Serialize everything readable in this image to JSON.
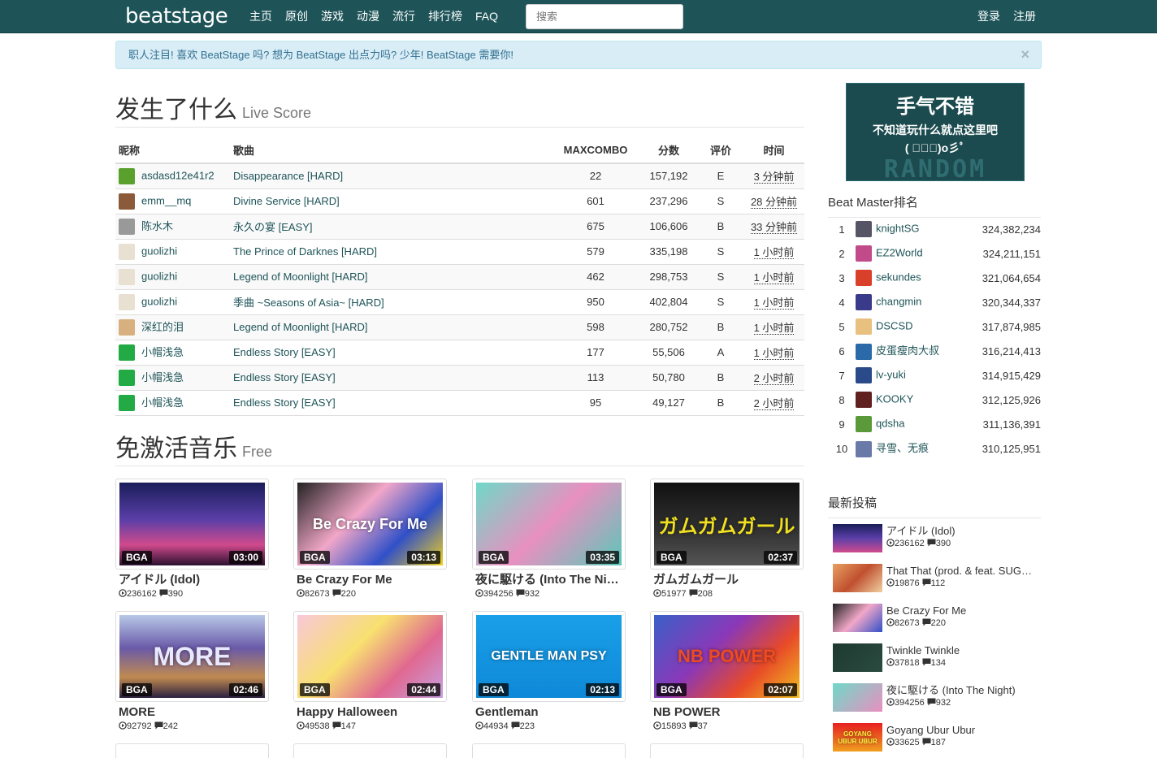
{
  "nav": {
    "logo": "beatstage",
    "links": [
      "主页",
      "原创",
      "游戏",
      "动漫",
      "流行",
      "排行榜",
      "FAQ"
    ],
    "search_placeholder": "搜索",
    "login": "登录",
    "register": "注册"
  },
  "alert": {
    "text": "职人注目! 喜欢 BeatStage 吗? 想为 BeatStage 出点力吗? 少年! BeatStage 需要你!",
    "close": "×"
  },
  "live": {
    "title": "发生了什么",
    "subtitle": "Live Score",
    "headers": [
      "昵称",
      "歌曲",
      "MAXCOMBO",
      "分数",
      "评价",
      "时间"
    ],
    "rows": [
      {
        "nick": "asdasd12e41r2",
        "song": "Disappearance [HARD]",
        "combo": "22",
        "score": "157,192",
        "grade": "E",
        "time": "3 分钟前"
      },
      {
        "nick": "emm__mq",
        "song": "Divine Service [HARD]",
        "combo": "601",
        "score": "237,296",
        "grade": "S",
        "time": "28 分钟前"
      },
      {
        "nick": "陈水木",
        "song": "永久の宴 [EASY]",
        "combo": "675",
        "score": "106,606",
        "grade": "B",
        "time": "33 分钟前"
      },
      {
        "nick": "guolizhi",
        "song": "The Prince of Darknes [HARD]",
        "combo": "579",
        "score": "335,198",
        "grade": "S",
        "time": "1 小时前"
      },
      {
        "nick": "guolizhi",
        "song": "Legend of Moonlight [HARD]",
        "combo": "462",
        "score": "298,753",
        "grade": "S",
        "time": "1 小时前"
      },
      {
        "nick": "guolizhi",
        "song": "季曲 ~Seasons of Asia~ [HARD]",
        "combo": "950",
        "score": "402,804",
        "grade": "S",
        "time": "1 小时前"
      },
      {
        "nick": "深红的泪",
        "song": "Legend of Moonlight [HARD]",
        "combo": "598",
        "score": "280,752",
        "grade": "B",
        "time": "1 小时前"
      },
      {
        "nick": "小帽浅急",
        "song": "Endless Story [EASY]",
        "combo": "177",
        "score": "55,506",
        "grade": "A",
        "time": "1 小时前"
      },
      {
        "nick": "小帽浅急",
        "song": "Endless Story [EASY]",
        "combo": "113",
        "score": "50,780",
        "grade": "B",
        "time": "2 小时前"
      },
      {
        "nick": "小帽浅急",
        "song": "Endless Story [EASY]",
        "combo": "95",
        "score": "49,127",
        "grade": "B",
        "time": "2 小时前"
      }
    ]
  },
  "free": {
    "title": "免激活音乐",
    "subtitle": "Free",
    "badge": "BGA",
    "cards": [
      {
        "title": "アイドル (Idol)",
        "duration": "03:00",
        "plays": "236162",
        "comments": "390",
        "art": ""
      },
      {
        "title": "Be Crazy For Me",
        "duration": "03:13",
        "plays": "82673",
        "comments": "220",
        "art": "Be Crazy For Me"
      },
      {
        "title": "夜に駆ける (Into The Night)",
        "duration": "03:35",
        "plays": "394256",
        "comments": "932",
        "art": ""
      },
      {
        "title": "ガムガムガール",
        "duration": "02:37",
        "plays": "51977",
        "comments": "208",
        "art": "ガムガムガール"
      },
      {
        "title": "MORE",
        "duration": "02:46",
        "plays": "92792",
        "comments": "242",
        "art": "MORE"
      },
      {
        "title": "Happy Halloween",
        "duration": "02:44",
        "plays": "49538",
        "comments": "147",
        "art": ""
      },
      {
        "title": "Gentleman",
        "duration": "02:13",
        "plays": "44934",
        "comments": "223",
        "art": "GENTLE MAN  PSY"
      },
      {
        "title": "NB POWER",
        "duration": "02:07",
        "plays": "15893",
        "comments": "37",
        "art": "NB POWER"
      }
    ]
  },
  "sidebar": {
    "banner": {
      "line1": "手气不错",
      "line2": "不知道玩什么就点这里吧",
      "line3": "( ﾟ∀ﾟ)o彡ﾟ",
      "bg": "RANDOM"
    },
    "rank_title": "Beat Master排名",
    "ranks": [
      {
        "num": "1",
        "name": "knightSG",
        "pts": "324,382,234"
      },
      {
        "num": "2",
        "name": "EZ2World",
        "pts": "324,211,151"
      },
      {
        "num": "3",
        "name": "sekundes",
        "pts": "321,064,654"
      },
      {
        "num": "4",
        "name": "changmin",
        "pts": "320,344,337"
      },
      {
        "num": "5",
        "name": "DSCSD",
        "pts": "317,874,985"
      },
      {
        "num": "6",
        "name": "皮蛋瘦肉大叔",
        "pts": "316,214,413"
      },
      {
        "num": "7",
        "name": "lv-yuki",
        "pts": "314,915,429"
      },
      {
        "num": "8",
        "name": "KOOKY",
        "pts": "312,125,926"
      },
      {
        "num": "9",
        "name": "qdsha",
        "pts": "311,136,391"
      },
      {
        "num": "10",
        "name": "寻雪、无痕",
        "pts": "310,125,951"
      }
    ],
    "latest_title": "最新投稿",
    "latest": [
      {
        "title": "アイドル (Idol)",
        "plays": "236162",
        "comments": "390"
      },
      {
        "title": "That That (prod. & feat. SUGA of BTS)",
        "plays": "19876",
        "comments": "112"
      },
      {
        "title": "Be Crazy For Me",
        "plays": "82673",
        "comments": "220"
      },
      {
        "title": "Twinkle Twinkle",
        "plays": "37818",
        "comments": "134"
      },
      {
        "title": "夜に駆ける (Into The Night)",
        "plays": "394256",
        "comments": "932"
      },
      {
        "title": "Goyang Ubur Ubur",
        "plays": "33625",
        "comments": "187",
        "art": "GOYANG UBUR UBUR"
      }
    ]
  },
  "colors": {
    "navbar": "#1e5458",
    "link": "#1e5458",
    "alert_bg": "#d9edf7",
    "alert_text": "#31708f"
  },
  "icons": {
    "plays": "play-circle-icon",
    "comments": "comment-icon",
    "close": "close-icon"
  }
}
